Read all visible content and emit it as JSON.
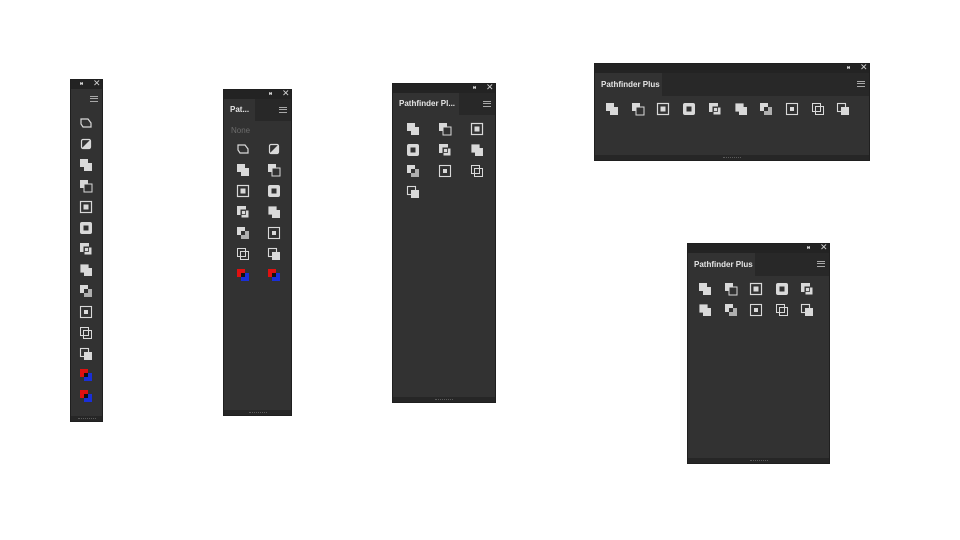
{
  "panels": [
    {
      "id": "strip",
      "tab_label": "",
      "buttons": [
        "shape-outline",
        "divide-half",
        "unite",
        "minus-front",
        "intersect",
        "exclude",
        "merge",
        "crop",
        "trim",
        "minus-back",
        "outline",
        "back-front",
        "color-split",
        "color-split"
      ]
    },
    {
      "id": "narrow",
      "tab_label": "Pat...",
      "none_label": "None",
      "buttons": [
        "shape-outline",
        "divide-half",
        "unite",
        "minus-front",
        "intersect",
        "exclude",
        "merge",
        "crop",
        "trim",
        "minus-back",
        "outline",
        "back-front",
        "color-split",
        "color-split"
      ]
    },
    {
      "id": "medium",
      "tab_label": "Pathfinder Pl...",
      "buttons": [
        "unite",
        "minus-front",
        "intersect",
        "exclude",
        "merge",
        "crop",
        "trim",
        "minus-back",
        "outline",
        "back-front"
      ]
    },
    {
      "id": "wide",
      "tab_label": "Pathfinder Plus",
      "buttons": [
        "unite",
        "minus-front",
        "intersect",
        "exclude",
        "merge",
        "crop",
        "trim",
        "minus-back",
        "outline",
        "back-front"
      ]
    },
    {
      "id": "square",
      "tab_label": "Pathfinder Plus",
      "buttons": [
        "unite",
        "minus-front",
        "intersect",
        "exclude",
        "merge",
        "crop",
        "trim",
        "minus-back",
        "outline",
        "back-front"
      ]
    }
  ],
  "controls": {
    "collapse_glyph": "◂▸",
    "close_glyph": "✕"
  },
  "colors": {
    "panel_bg": "#323232",
    "icon_light": "#d9d9d9",
    "icon_dark": "#3a3a3a",
    "split_red": "#e01010",
    "split_blue": "#1a2fd8"
  }
}
